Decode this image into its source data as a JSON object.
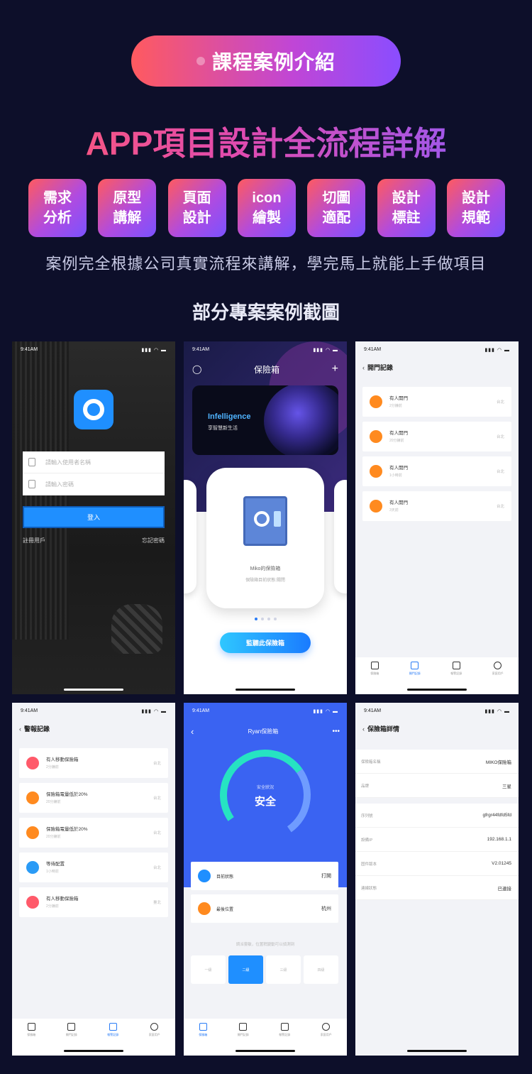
{
  "header": {
    "pill_title": "課程案例介紹",
    "main_title": "APP項目設計全流程詳解",
    "tags": [
      {
        "line1": "需求",
        "line2": "分析"
      },
      {
        "line1": "原型",
        "line2": "講解"
      },
      {
        "line1": "頁面",
        "line2": "設計"
      },
      {
        "line1": "icon",
        "line2": "繪製"
      },
      {
        "line1": "切圖",
        "line2": "適配"
      },
      {
        "line1": "設計",
        "line2": "標註"
      },
      {
        "line1": "設計",
        "line2": "規範"
      }
    ],
    "subtitle": "案例完全根據公司真實流程來講解，學完馬上就能上手做項目",
    "section_title": "部分專案案例截圖"
  },
  "status_bar": {
    "time": "9:41AM"
  },
  "login": {
    "username_placeholder": "請輸入使用者名稱",
    "password_placeholder": "請輸入密碼",
    "login_label": "登入",
    "register_label": "註冊用戶",
    "forgot_label": "忘記密碼"
  },
  "safebox": {
    "title": "保險箱",
    "banner_title": "Infelligence",
    "banner_sub": "享智慧新生活",
    "card_name": "Miko的保險箱",
    "card_status": "保險箱目前狀態:關閉",
    "listen_label": "監聽此保險箱"
  },
  "door_records": {
    "title": "開門記錄",
    "items": [
      {
        "title": "有人開門",
        "time": "2分鐘前",
        "place": "台北"
      },
      {
        "title": "有人開門",
        "time": "20分鐘前",
        "place": "台北"
      },
      {
        "title": "有人開門",
        "time": "1小時前",
        "place": "台北"
      },
      {
        "title": "有人開門",
        "time": "3天前",
        "place": "台北"
      }
    ]
  },
  "alarm_records": {
    "title": "警報記錄",
    "items": [
      {
        "title": "有人移動保險箱",
        "time": "2分鐘前",
        "place": "台北"
      },
      {
        "title": "保險箱電量低於20%",
        "time": "20分鐘前",
        "place": "台北"
      },
      {
        "title": "保險箱電量低於20%",
        "time": "20分鐘前",
        "place": "台北"
      },
      {
        "title": "等待配置",
        "time": "1小時前",
        "place": "台北"
      },
      {
        "title": "有人移動保險箱",
        "time": "2分鐘前",
        "place": "臺北"
      }
    ]
  },
  "tabbar": {
    "tabs": [
      "保險箱",
      "開門記錄",
      "報警記錄",
      "家庭用戶"
    ]
  },
  "ryan": {
    "title": "Ryan保險箱",
    "gauge_label": "安全狀況",
    "gauge_value": "安全",
    "rows": [
      {
        "key": "目前狀態",
        "value": "打開"
      },
      {
        "key": "最後位置",
        "value": "杭州"
      }
    ],
    "hint": "調派靈敏，位置稍變動可以偵測到",
    "levels": [
      "一級",
      "二級",
      "三級",
      "四級"
    ]
  },
  "detail": {
    "title": "保險箱詳情",
    "rows_a": [
      {
        "key": "保險箱名稱",
        "value": "MIKO保險箱"
      },
      {
        "key": "品牌",
        "value": "三星"
      }
    ],
    "rows_b": [
      {
        "key": "序列號",
        "value": "gfrgr44fdfd5fd"
      },
      {
        "key": "設備IP",
        "value": "192.168.1.1"
      },
      {
        "key": "固件版本",
        "value": "V2.01245"
      },
      {
        "key": "連線狀態",
        "value": "已連接"
      }
    ]
  }
}
